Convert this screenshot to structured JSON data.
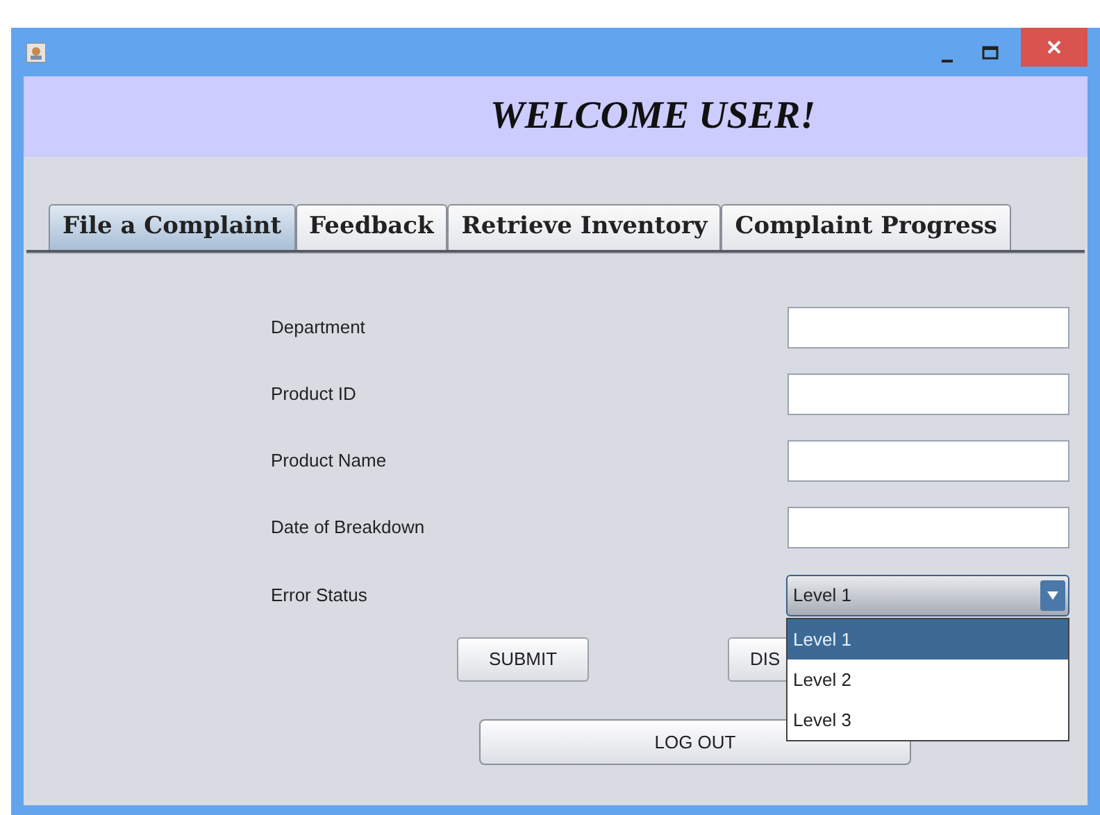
{
  "header": {
    "title": "WELCOME USER!"
  },
  "tabs": [
    {
      "label": "File a Complaint",
      "selected": true
    },
    {
      "label": "Feedback",
      "selected": false
    },
    {
      "label": "Retrieve Inventory",
      "selected": false
    },
    {
      "label": "Complaint Progress",
      "selected": false
    }
  ],
  "form": {
    "fields": [
      {
        "label": "Department",
        "kind": "text"
      },
      {
        "label": "Product ID",
        "kind": "text"
      },
      {
        "label": "Product Name",
        "kind": "text"
      },
      {
        "label": "Date of Breakdown",
        "kind": "text"
      }
    ],
    "error_status": {
      "label": "Error Status",
      "value": "Level 1",
      "expanded": true,
      "options": [
        {
          "label": "Level 1",
          "selected": true
        },
        {
          "label": "Level 2",
          "selected": false
        },
        {
          "label": "Level 3",
          "selected": false
        }
      ]
    }
  },
  "buttons": [
    {
      "label": "SUBMIT"
    },
    {
      "label": "DIS"
    }
  ],
  "logout": {
    "label": "LOG OUT"
  }
}
